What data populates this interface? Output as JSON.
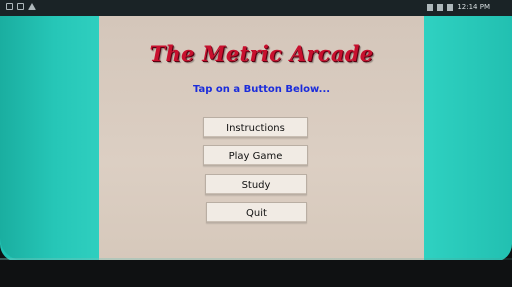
{
  "status_bar": {
    "left_icons": [
      "image-icon",
      "sync-icon",
      "warning-icon"
    ],
    "right_text": "12:14 PM"
  },
  "game": {
    "title": "The Metric Arcade",
    "subtitle": "Tap on a Button Below...",
    "buttons": [
      {
        "label": "Instructions"
      },
      {
        "label": "Play Game"
      },
      {
        "label": "Study"
      },
      {
        "label": "Quit"
      }
    ]
  },
  "colors": {
    "background_teal": "#22c2b3",
    "panel": "#d8cabd",
    "title_red": "#c8102e",
    "subtitle_blue": "#1b2cdb"
  }
}
